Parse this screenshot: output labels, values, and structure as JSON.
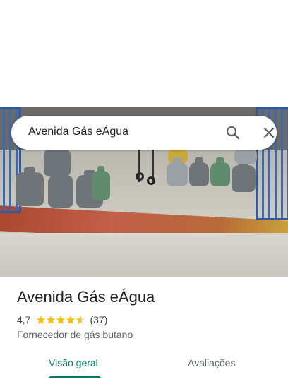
{
  "search": {
    "query": "Avenida Gás eÁgua"
  },
  "place": {
    "name": "Avenida Gás eÁgua",
    "rating": "4,7",
    "rating_stars": 4.7,
    "review_count": "(37)",
    "category": "Fornecedor de gás butano"
  },
  "tabs": [
    {
      "label": "Visão geral",
      "selected": true
    },
    {
      "label": "Avaliações",
      "selected": false
    }
  ],
  "colors": {
    "accent": "#00796b",
    "star": "#fbbc04"
  },
  "icons": [
    "search-icon",
    "close-icon",
    "star-icon"
  ]
}
